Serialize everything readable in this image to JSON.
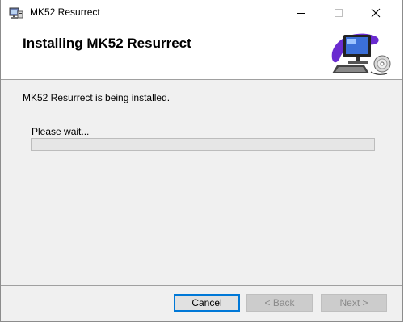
{
  "window": {
    "title": "MK52 Resurrect"
  },
  "header": {
    "title": "Installing MK52 Resurrect"
  },
  "main": {
    "status": "MK52 Resurrect is being installed.",
    "wait_label": "Please wait...",
    "progress_fraction": 0
  },
  "footer": {
    "cancel_label": "Cancel",
    "back_label": "< Back",
    "next_label": "Next >"
  },
  "colors": {
    "focus_border": "#0078d7",
    "header_bg": "#ffffff",
    "body_bg": "#f0f0f0"
  },
  "icons": {
    "app": "installer-app-icon",
    "header": "computer-setup-graphic",
    "minimize": "minimize-icon",
    "maximize": "maximize-icon",
    "close": "close-icon"
  }
}
